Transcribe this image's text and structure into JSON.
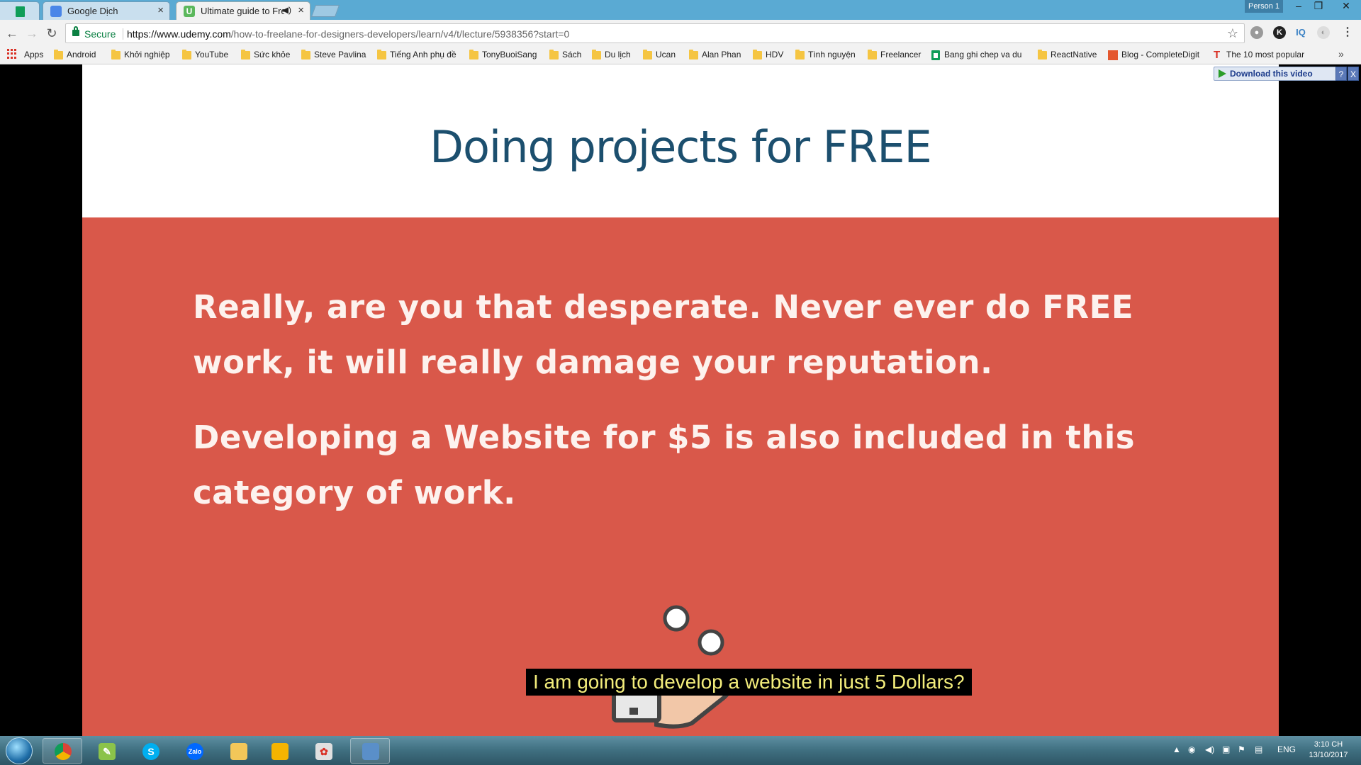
{
  "browser": {
    "tabs": [
      {
        "title": "Google Dịch",
        "active": false
      },
      {
        "title": "Ultimate guide to Fre",
        "active": true
      }
    ],
    "profile": "Person 1",
    "secure_label": "Secure",
    "url_domain": "https://www.udemy.com",
    "url_path": "/how-to-freelane-for-designers-developers/learn/v4/t/lecture/5938356?start=0"
  },
  "bookmarks": [
    "Apps",
    "Android",
    "Khởi nghiệp",
    "YouTube",
    "Sức khỏe",
    "Steve Pavlina",
    "Tiếng Anh phụ đề",
    "TonyBuoiSang",
    "Sách",
    "Du lịch",
    "Ucan",
    "Alan Phan",
    "HDV",
    "Tình nguyện",
    "Freelancer",
    "Bang ghi chep va du",
    "ReactNative",
    "Blog - CompleteDigit",
    "The 10 most popular"
  ],
  "video": {
    "download_label": "Download this video",
    "help_label": "?",
    "close_label": "X",
    "slide_title": "Doing projects for FREE",
    "paragraph_1": "Really, are you that desperate. Never ever do FREE work, it will really damage your reputation.",
    "paragraph_2": "Developing a Website for $5 is also included in this category of work.",
    "caption": "I am going to develop a website in just 5 Dollars?"
  },
  "taskbar": {
    "apps": [
      "chrome",
      "notepad",
      "skype",
      "zalo",
      "explorer",
      "files",
      "paint",
      "photos"
    ],
    "lang": "ENG",
    "time": "3:10 CH",
    "date": "13/10/2017"
  },
  "colors": {
    "slide_red": "#d9584a",
    "title_blue": "#1c4f6e",
    "caption_yellow": "#f3ed7b",
    "tab_bar": "#5aaad3"
  }
}
